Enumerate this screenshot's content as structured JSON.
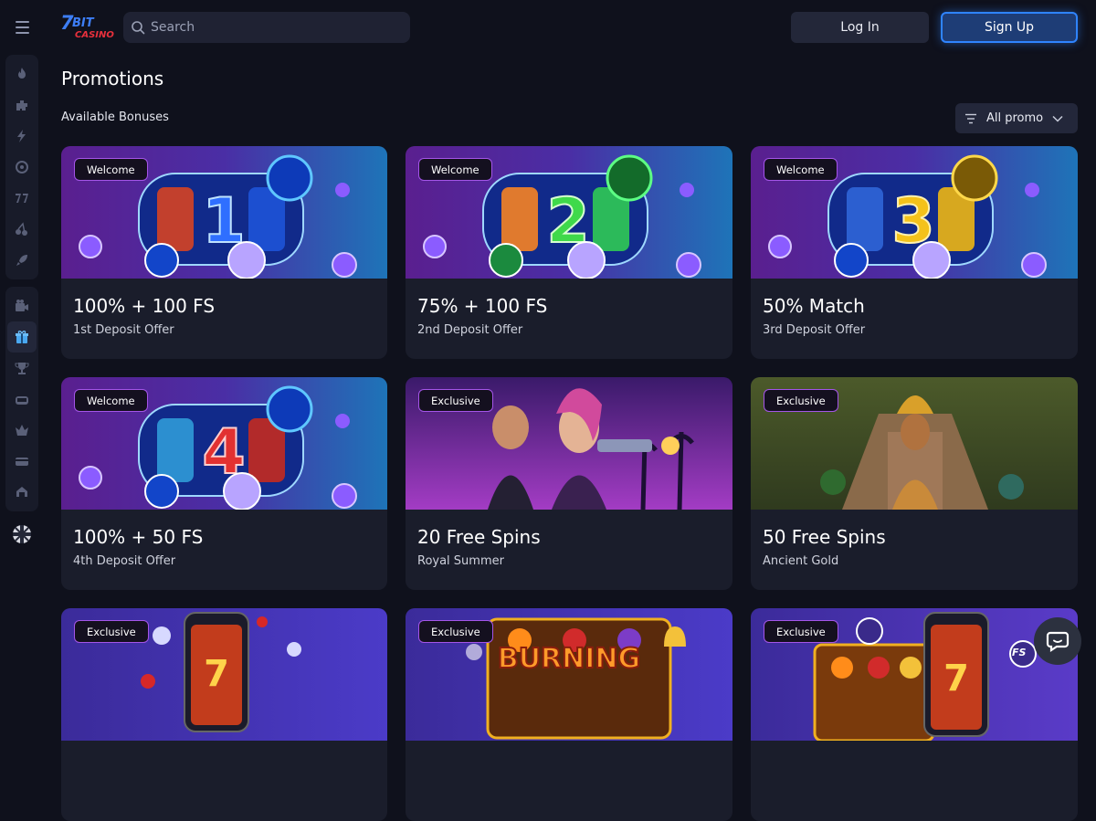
{
  "header": {
    "logo_text": "7BIT CASINO",
    "search_placeholder": "Search",
    "login_label": "Log In",
    "signup_label": "Sign Up",
    "signup_accent": "#2f84ff"
  },
  "sidebar": {
    "group1": [
      "fire-icon",
      "puzzle-icon",
      "lightning-icon",
      "target-icon",
      "sevens-icon",
      "cherries-icon",
      "rocket-icon"
    ],
    "group2": [
      "live-casino-icon",
      "gift-icon",
      "trophy-icon",
      "jackpot-icon",
      "crown-icon",
      "wallet-icon",
      "vip-icon"
    ],
    "active_item": "gift-icon",
    "language_flag": "uk-flag-icon"
  },
  "main": {
    "title": "Promotions",
    "subtitle": "Available Bonuses",
    "filter_label": "All promo"
  },
  "cards": [
    {
      "badge": "Welcome",
      "title": "100% + 100 FS",
      "subtitle": "1st Deposit Offer",
      "art": "reel-1"
    },
    {
      "badge": "Welcome",
      "title": "75% + 100 FS",
      "subtitle": "2nd Deposit Offer",
      "art": "reel-2"
    },
    {
      "badge": "Welcome",
      "title": "50% Match",
      "subtitle": "3rd Deposit Offer",
      "art": "reel-3"
    },
    {
      "badge": "Welcome",
      "title": "100% + 50 FS",
      "subtitle": "4th Deposit Offer",
      "art": "reel-4"
    },
    {
      "badge": "Exclusive",
      "title": "20 Free Spins",
      "subtitle": "Royal Summer",
      "art": "shooter"
    },
    {
      "badge": "Exclusive",
      "title": "50 Free Spins",
      "subtitle": "Ancient Gold",
      "art": "temple"
    },
    {
      "badge": "Exclusive",
      "title": "",
      "subtitle": "",
      "art": "phone-slots"
    },
    {
      "badge": "Exclusive",
      "title": "",
      "subtitle": "",
      "art": "burning",
      "art_text": "BURNING"
    },
    {
      "badge": "Exclusive",
      "title": "",
      "subtitle": "",
      "art": "fs-fruits",
      "art_text": "FS"
    }
  ],
  "colors": {
    "background": "#0f111c",
    "card": "#1a1d2b",
    "badge_border": "#a455e8"
  }
}
